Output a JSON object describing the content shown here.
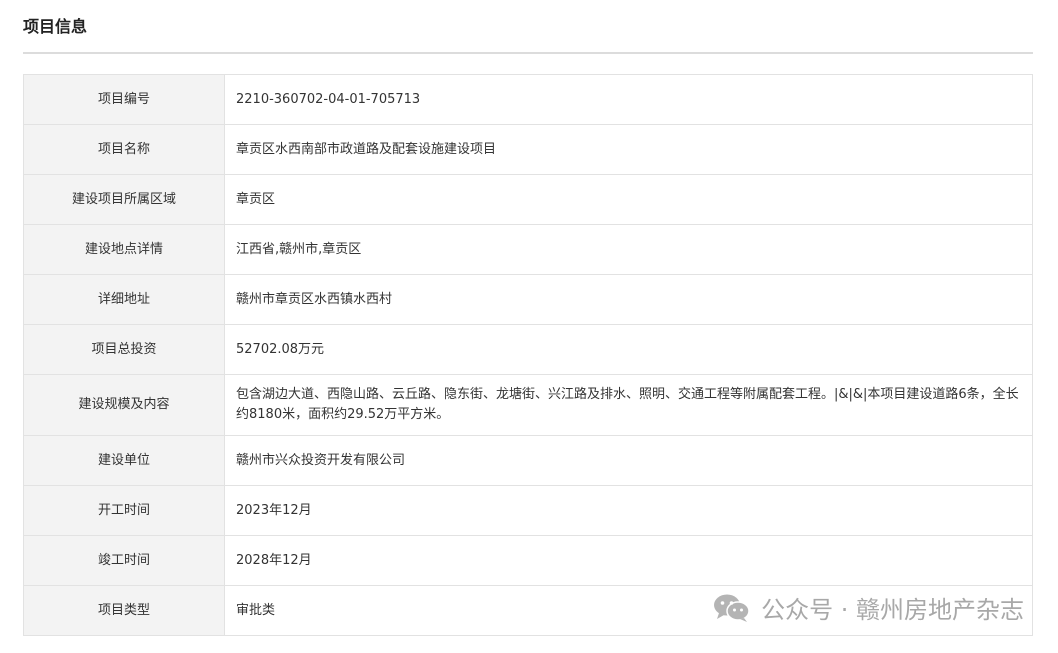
{
  "section": {
    "title": "项目信息"
  },
  "rows": [
    {
      "label": "项目编号",
      "value": "2210-360702-04-01-705713"
    },
    {
      "label": "项目名称",
      "value": "章贡区水西南部市政道路及配套设施建设项目"
    },
    {
      "label": "建设项目所属区域",
      "value": "章贡区"
    },
    {
      "label": "建设地点详情",
      "value": "江西省,赣州市,章贡区"
    },
    {
      "label": "详细地址",
      "value": "赣州市章贡区水西镇水西村"
    },
    {
      "label": "项目总投资",
      "value": "52702.08万元"
    },
    {
      "label": "建设规模及内容",
      "value": "包含湖边大道、西隐山路、云丘路、隐东街、龙塘街、兴江路及排水、照明、交通工程等附属配套工程。|&|&|本项目建设道路6条，全长约8180米，面积约29.52万平方米。"
    },
    {
      "label": "建设单位",
      "value": "赣州市兴众投资开发有限公司"
    },
    {
      "label": "开工时间",
      "value": "2023年12月"
    },
    {
      "label": "竣工时间",
      "value": "2028年12月"
    },
    {
      "label": "项目类型",
      "value": "审批类"
    }
  ],
  "watermark": {
    "icon": "wechat-icon",
    "text": "公众号 · 赣州房地产杂志"
  }
}
